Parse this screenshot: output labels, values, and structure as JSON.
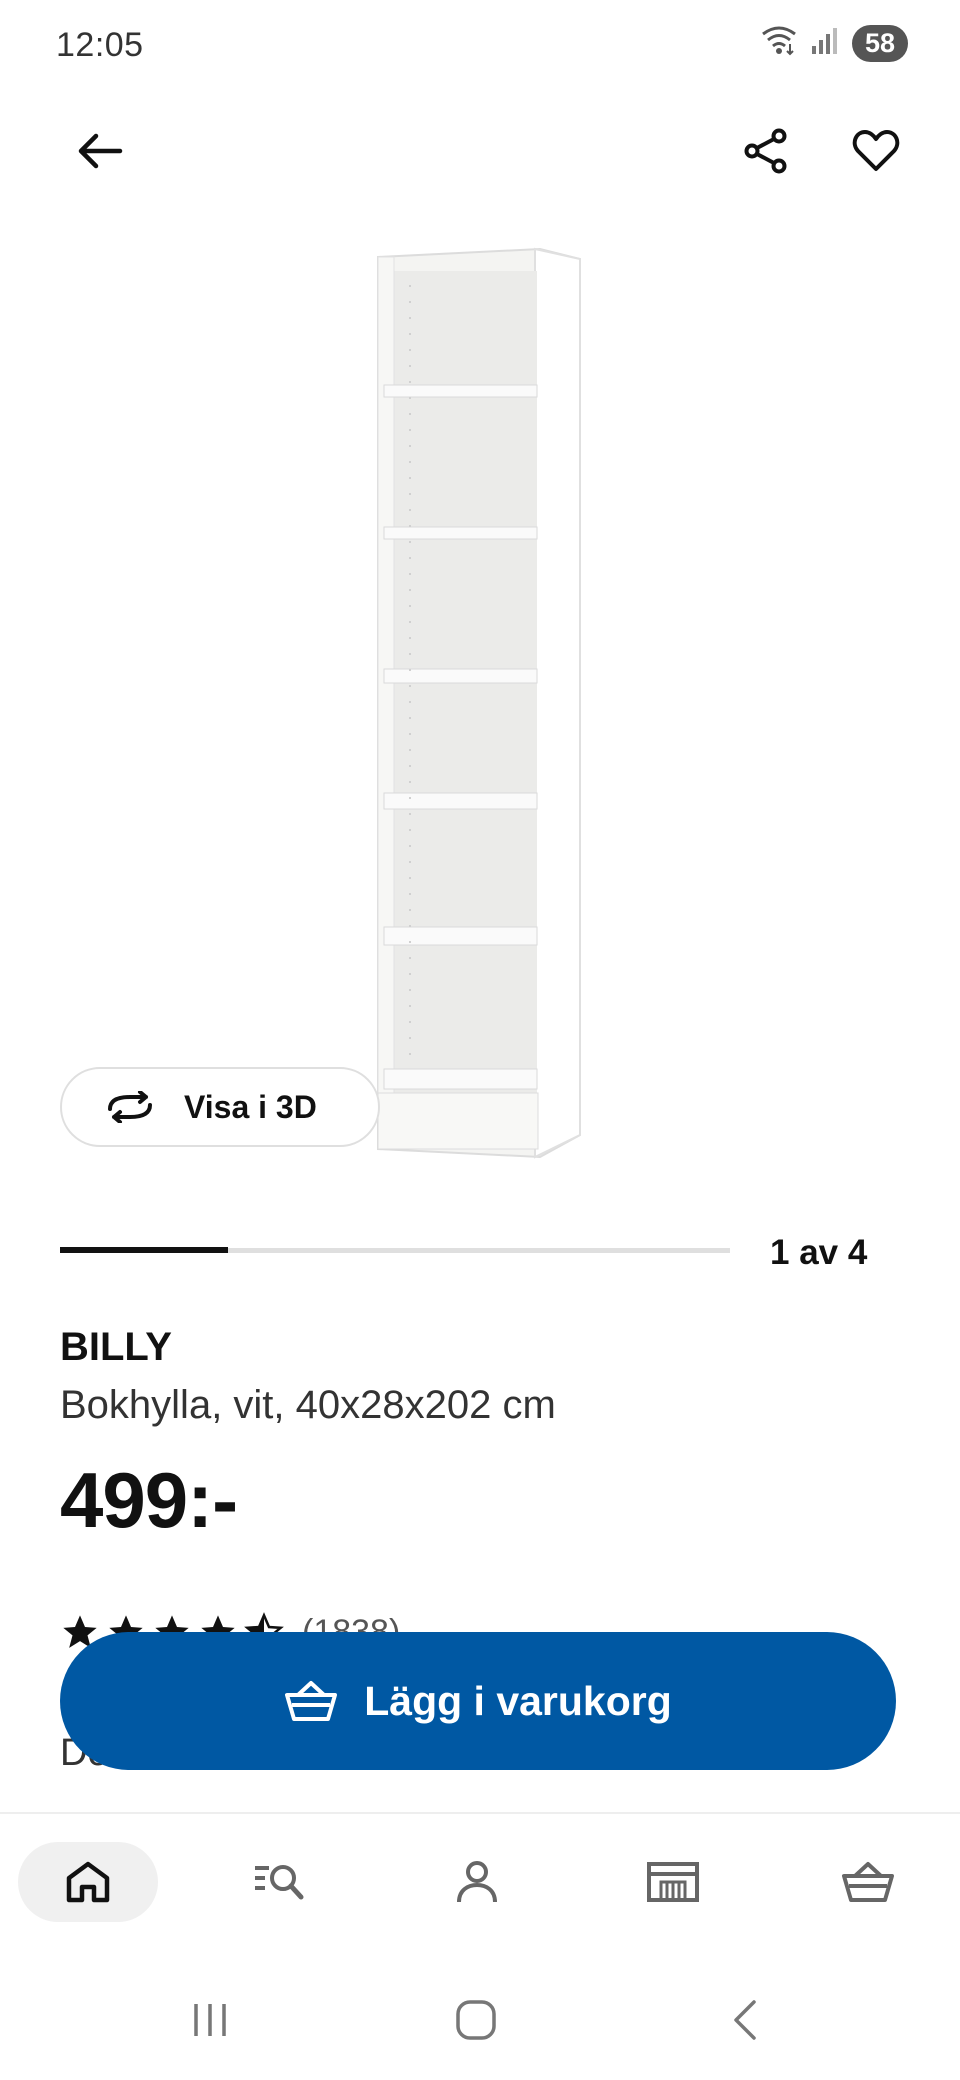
{
  "status_bar": {
    "time": "12:05",
    "battery": "58",
    "icons": [
      "wifi-icon",
      "signal-icon",
      "battery-icon"
    ]
  },
  "top_nav": {
    "back_icon": "arrow-left-icon",
    "share_icon": "share-icon",
    "favorite_icon": "heart-icon"
  },
  "product": {
    "image": "bookshelf-image",
    "view_3d_label": "Visa i 3D",
    "gallery_position": "1 av 4",
    "gallery_progress": 0.25,
    "name": "BILLY",
    "description": "Bokhylla, vit, 40x28x202 cm",
    "price": "499:-",
    "rating": 4.5,
    "review_count": "(1838)",
    "partial_row_text": "De"
  },
  "actions": {
    "add_to_cart_label": "Lägg i varukorg",
    "add_to_cart_icon": "shopping-basket-icon",
    "button_color": "#0058a3"
  },
  "bottom_nav": {
    "items": [
      {
        "name": "home",
        "icon": "home-icon",
        "active": true
      },
      {
        "name": "search",
        "icon": "search-list-icon",
        "active": false
      },
      {
        "name": "profile",
        "icon": "person-icon",
        "active": false
      },
      {
        "name": "store",
        "icon": "store-icon",
        "active": false
      },
      {
        "name": "cart",
        "icon": "basket-icon",
        "active": false
      }
    ]
  },
  "android_nav": {
    "icons": [
      "recent-apps-icon",
      "home-button-icon",
      "back-icon"
    ]
  }
}
